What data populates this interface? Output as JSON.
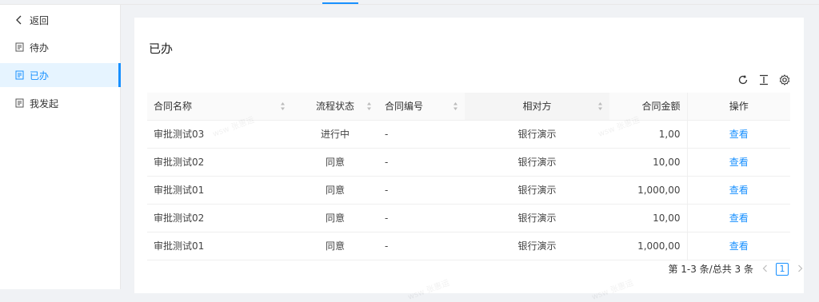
{
  "sidebar": {
    "back": "返回",
    "items": [
      {
        "label": "待办",
        "active": false
      },
      {
        "label": "已办",
        "active": true
      },
      {
        "label": "我发起",
        "active": false
      }
    ]
  },
  "page": {
    "title": "已办"
  },
  "table": {
    "columns": [
      "合同名称",
      "流程状态",
      "合同编号",
      "相对方",
      "合同金额",
      "操作"
    ],
    "rows": [
      {
        "name": "审批测试03",
        "status": "进行中",
        "code": "-",
        "party": "银行演示",
        "amount": "1,00",
        "action": "查看"
      },
      {
        "name": "审批测试02",
        "status": "同意",
        "code": "-",
        "party": "银行演示",
        "amount": "10,00",
        "action": "查看"
      },
      {
        "name": "审批测试01",
        "status": "同意",
        "code": "-",
        "party": "银行演示",
        "amount": "1,000,00",
        "action": "查看"
      },
      {
        "name": "审批测试02",
        "status": "同意",
        "code": "-",
        "party": "银行演示",
        "amount": "10,00",
        "action": "查看"
      },
      {
        "name": "审批测试01",
        "status": "同意",
        "code": "-",
        "party": "银行演示",
        "amount": "1,000,00",
        "action": "查看"
      }
    ]
  },
  "pagination": {
    "summary": "第 1-3 条/总共 3 条",
    "current": "1"
  },
  "watermark": "wsw 张惠运",
  "colors": {
    "accent": "#1890ff",
    "active_bg": "#e6f4ff"
  }
}
